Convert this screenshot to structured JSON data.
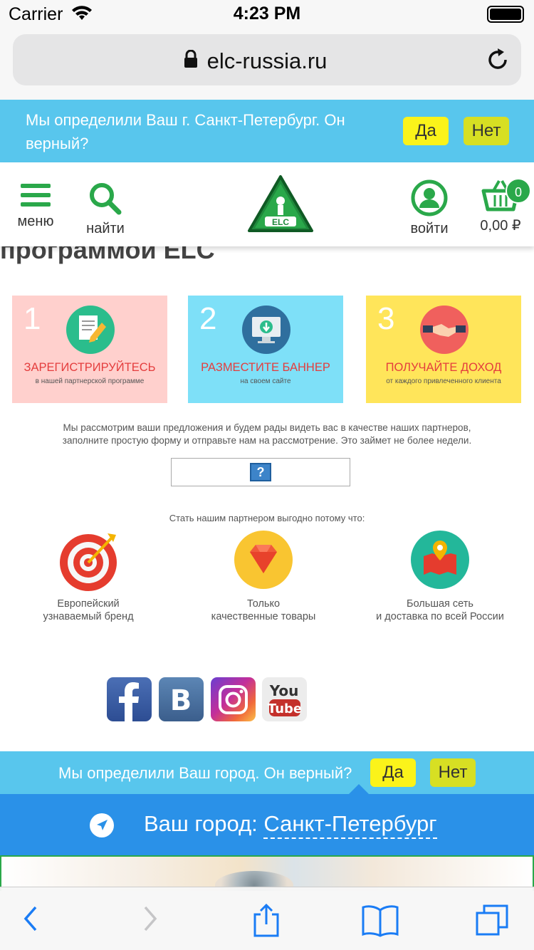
{
  "status_bar": {
    "carrier": "Carrier",
    "time": "4:23 PM"
  },
  "browser": {
    "url": "elc-russia.ru"
  },
  "city_prompt_top": {
    "text": "Мы определили Ваш г. Санкт-Петербург. Он верный?",
    "yes": "Да",
    "no": "Нет"
  },
  "header": {
    "menu_label": "меню",
    "search_label": "найти",
    "login_label": "войти",
    "cart_count": "0",
    "cart_total": "0,00 ₽",
    "logo_text": "ELC"
  },
  "page": {
    "partial_heading": "программой ELC",
    "steps": [
      {
        "number": "1",
        "title": "ЗАРЕГИСТРИРУЙТЕСЬ",
        "subtitle": "в нашей партнерской программе",
        "icon": "document-pencil-icon",
        "bg": "#ffd0cd"
      },
      {
        "number": "2",
        "title": "РАЗМЕСТИТЕ БАННЕР",
        "subtitle": "на своем сайте",
        "icon": "monitor-download-icon",
        "bg": "#7ee0f8"
      },
      {
        "number": "3",
        "title": "ПОЛУЧАЙТЕ ДОХОД",
        "subtitle": "от каждого привлеченного клиента",
        "icon": "handshake-icon",
        "bg": "#ffe55a"
      }
    ],
    "paragraph_line1": "Мы рассмотрим ваши предложения и будем рады видеть вас в качестве наших партнеров,",
    "paragraph_line2": "заполните простую форму и отправьте нам на рассмотрение. Это займет не более недели.",
    "benefits_title": "Стать нашим партнером выгодно потому что:",
    "benefits": [
      {
        "line1": "Европейский",
        "line2": "узнаваемый бренд",
        "icon": "target-icon"
      },
      {
        "line1": "Только",
        "line2": "качественные товары",
        "icon": "gem-icon"
      },
      {
        "line1": "Большая сеть",
        "line2": "и доставка по всей России",
        "icon": "map-pin-icon"
      }
    ],
    "socials": [
      "facebook-icon",
      "vkontakte-icon",
      "instagram-icon",
      "youtube-icon"
    ]
  },
  "city_prompt_bottom": {
    "text": "Мы определили Ваш город. Он верный?",
    "yes": "Да",
    "no": "Нет"
  },
  "city_selector": {
    "label": "Ваш город:",
    "city": "Санкт-Петербург"
  },
  "colors": {
    "brand_green": "#2aa84a",
    "city_bar": "#58c6ed",
    "city_selector": "#2a91e8",
    "step_title": "#e43d3d"
  }
}
